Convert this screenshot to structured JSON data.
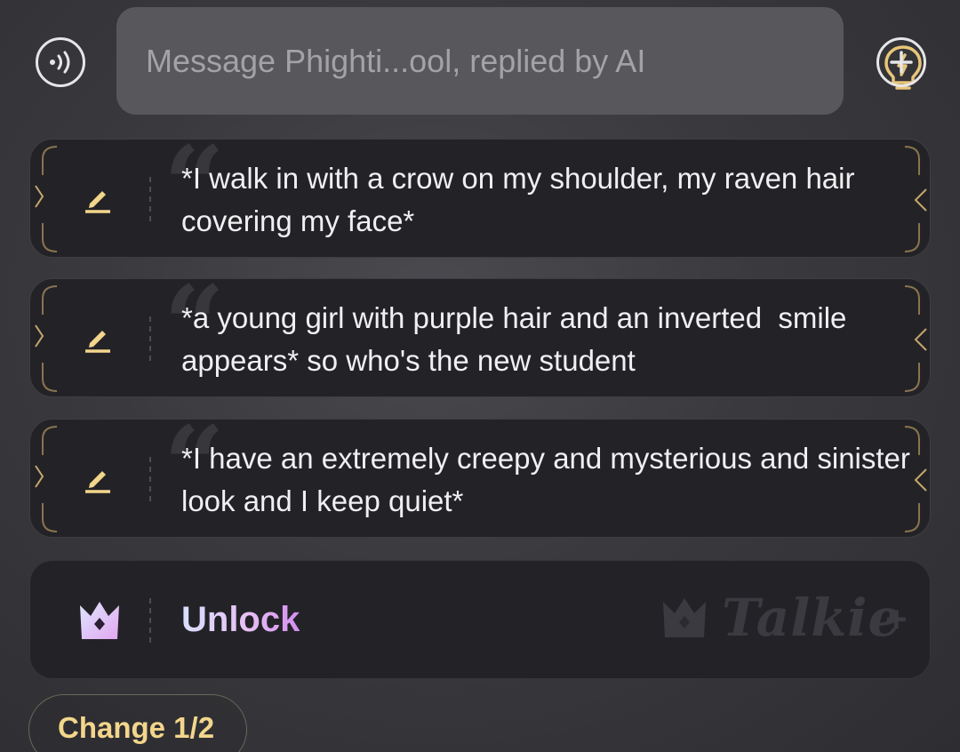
{
  "input": {
    "placeholder": "Message Phighti...ool, replied by AI"
  },
  "icons": {
    "voice": "voice-wave-icon",
    "hint": "lightbulb-bolt-icon",
    "add": "plus-circle-icon",
    "edit": "pencil-icon",
    "crown": "crown-icon"
  },
  "suggestions": [
    {
      "text": "*I walk in with a crow on my shoulder, my raven hair covering my face*"
    },
    {
      "text": "*a young girl with purple hair and an inverted  smile appears* so who's the new student"
    },
    {
      "text": "*I have an extremely creepy and mysterious and sinister look and I keep quiet*"
    }
  ],
  "unlock": {
    "label": "Unlock",
    "brand": "Talkie",
    "brand_suffix": "+"
  },
  "change": {
    "label": "Change 1/2"
  },
  "colors": {
    "accent_gold": "#f3d68c",
    "card_bg": "#232327",
    "input_bg": "#58585c",
    "unlock_gradient_start": "#d8e0ff",
    "unlock_gradient_end": "#d38ef0"
  }
}
